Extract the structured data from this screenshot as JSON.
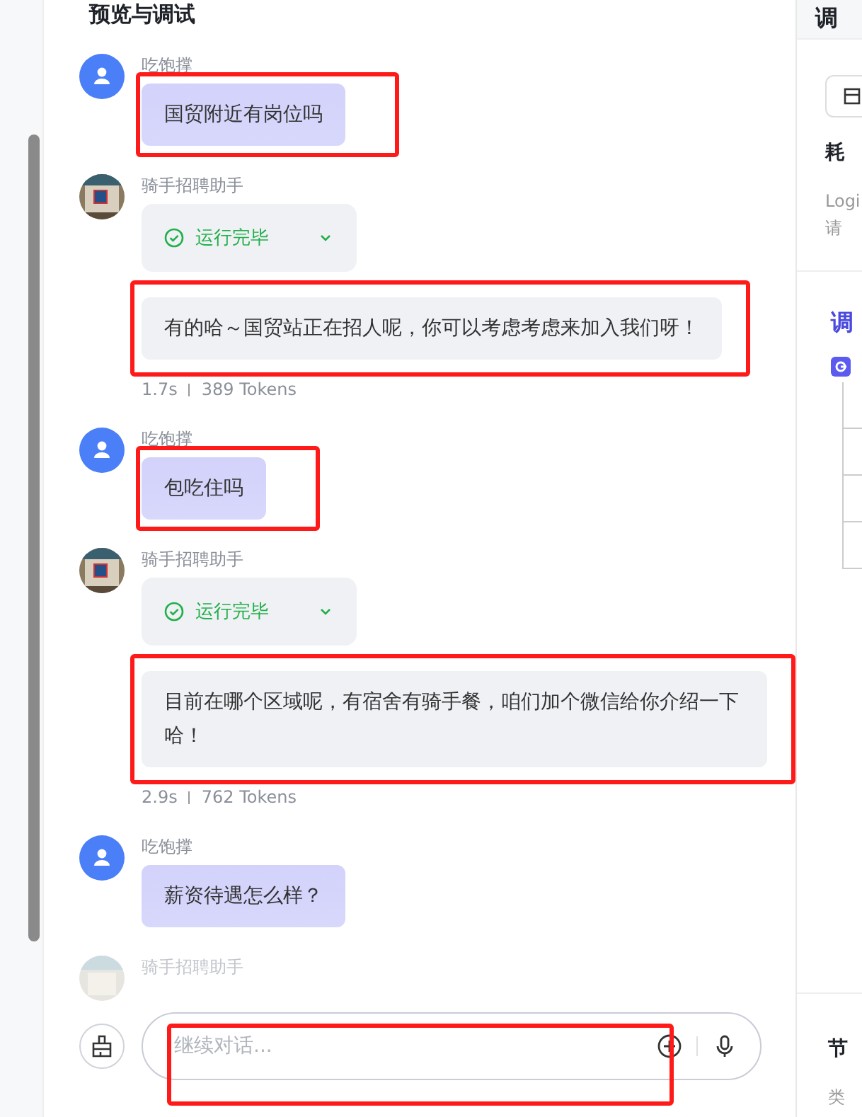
{
  "header": {
    "title": "预览与调试"
  },
  "messages": [
    {
      "kind": "user",
      "name": "吃饱撑",
      "text": "国贸附近有岗位吗",
      "annotated": true
    },
    {
      "kind": "bot",
      "name": "骑手招聘助手",
      "status": "运行完毕",
      "text": "有的哈～国贸站正在招人呢，你可以考虑考虑来加入我们呀！",
      "time": "1.7s",
      "tokens": "389 Tokens",
      "annotated": true
    },
    {
      "kind": "user",
      "name": "吃饱撑",
      "text": "包吃住吗",
      "annotated": true
    },
    {
      "kind": "bot",
      "name": "骑手招聘助手",
      "status": "运行完毕",
      "text": "目前在哪个区域呢，有宿舍有骑手餐，咱们加个微信给你介绍一下哈！",
      "time": "2.9s",
      "tokens": "762 Tokens",
      "annotated": true
    },
    {
      "kind": "user",
      "name": "吃饱撑",
      "text": "薪资待遇怎么样？"
    },
    {
      "kind": "bot_faded",
      "name": "骑手招聘助手"
    }
  ],
  "input": {
    "placeholder": "继续对话...",
    "annotated": true
  },
  "side_panel": {
    "heading": "调",
    "duration_label": "耗",
    "log_label": "Logi",
    "request_label": "请",
    "debug_tab": "调",
    "node_label": "节",
    "type_label": "类"
  }
}
